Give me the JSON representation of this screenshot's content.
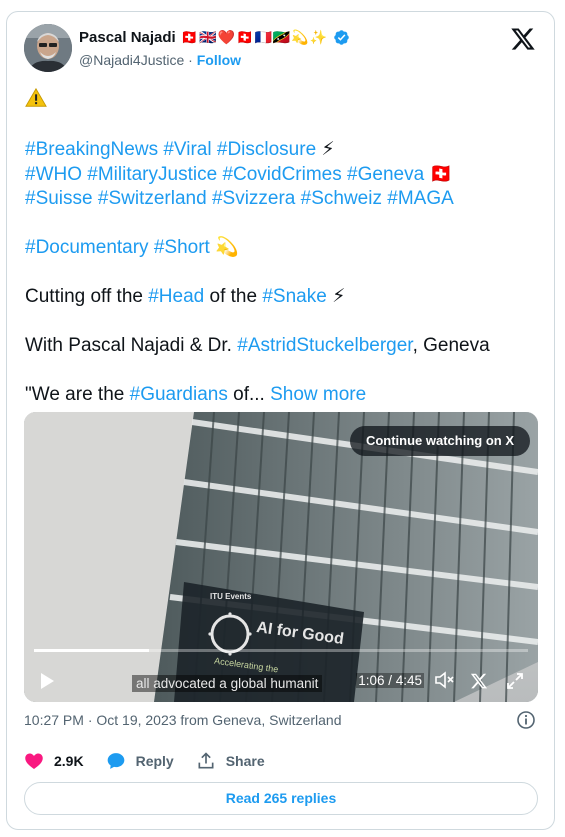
{
  "author": {
    "name": "Pascal Najadi",
    "name_emojis": "🇨🇭🇬🇧❤️🇨🇭🇫🇷🇰🇳💫✨",
    "handle": "@Najadi4Justice",
    "separator": " · ",
    "follow_label": "Follow"
  },
  "tweet": {
    "warning": "",
    "line1": [
      {
        "t": "#BreakingNews",
        "tag": true
      },
      {
        "t": " ",
        "tag": false
      },
      {
        "t": "#Viral",
        "tag": true
      },
      {
        "t": " ",
        "tag": false
      },
      {
        "t": "#Disclosure",
        "tag": true
      },
      {
        "t": " ⚡",
        "tag": false
      }
    ],
    "line2": [
      {
        "t": "#WHO",
        "tag": true
      },
      {
        "t": " ",
        "tag": false
      },
      {
        "t": "#MilitaryJustice",
        "tag": true
      },
      {
        "t": " ",
        "tag": false
      },
      {
        "t": "#CovidCrimes",
        "tag": true
      },
      {
        "t": " ",
        "tag": false
      },
      {
        "t": "#Geneva",
        "tag": true
      },
      {
        "t": " 🇨🇭",
        "tag": false
      }
    ],
    "line3": [
      {
        "t": "#Suisse",
        "tag": true
      },
      {
        "t": " ",
        "tag": false
      },
      {
        "t": "#Switzerland",
        "tag": true
      },
      {
        "t": " ",
        "tag": false
      },
      {
        "t": "#Svizzera",
        "tag": true
      },
      {
        "t": " ",
        "tag": false
      },
      {
        "t": "#Schweiz",
        "tag": true
      },
      {
        "t": " ",
        "tag": false
      },
      {
        "t": "#MAGA",
        "tag": true
      }
    ],
    "line4": [
      {
        "t": "#Documentary",
        "tag": true
      },
      {
        "t": " ",
        "tag": false
      },
      {
        "t": "#Short",
        "tag": true
      },
      {
        "t": " 💫",
        "tag": false
      }
    ],
    "line5": [
      {
        "t": "Cutting off the ",
        "tag": false
      },
      {
        "t": "#Head",
        "tag": true
      },
      {
        "t": " of the ",
        "tag": false
      },
      {
        "t": "#Snake",
        "tag": true
      },
      {
        "t": " ⚡",
        "tag": false
      }
    ],
    "line6": [
      {
        "t": "With Pascal Najadi & Dr. ",
        "tag": false
      },
      {
        "t": "#AstridStuckelberger",
        "tag": true
      },
      {
        "t": ", Geneva",
        "tag": false
      }
    ],
    "line7": [
      {
        "t": "\"We are the ",
        "tag": false
      },
      {
        "t": "#Guardians",
        "tag": true
      },
      {
        "t": " of... ",
        "tag": false
      }
    ],
    "show_more": "Show more"
  },
  "video": {
    "continue_label": "Continue watching on X",
    "caption": "all advocated a global humanit",
    "time": "1:06 / 4:45",
    "progress_fraction": 0.233,
    "sign_line1": "ITU Events",
    "sign_logo_text": "AI for Good",
    "sign_line2": "Accelerating the"
  },
  "meta": {
    "timestamp": "10:27 PM · Oct 19, 2023 from Geneva, Switzerland"
  },
  "actions": {
    "likes": "2.9K",
    "reply_label": "Reply",
    "share_label": "Share"
  },
  "read_replies_label": "Read 265 replies",
  "colors": {
    "accent": "#1d9bf0",
    "like": "#f91880",
    "text": "#0f1419",
    "secondary": "#536471"
  }
}
